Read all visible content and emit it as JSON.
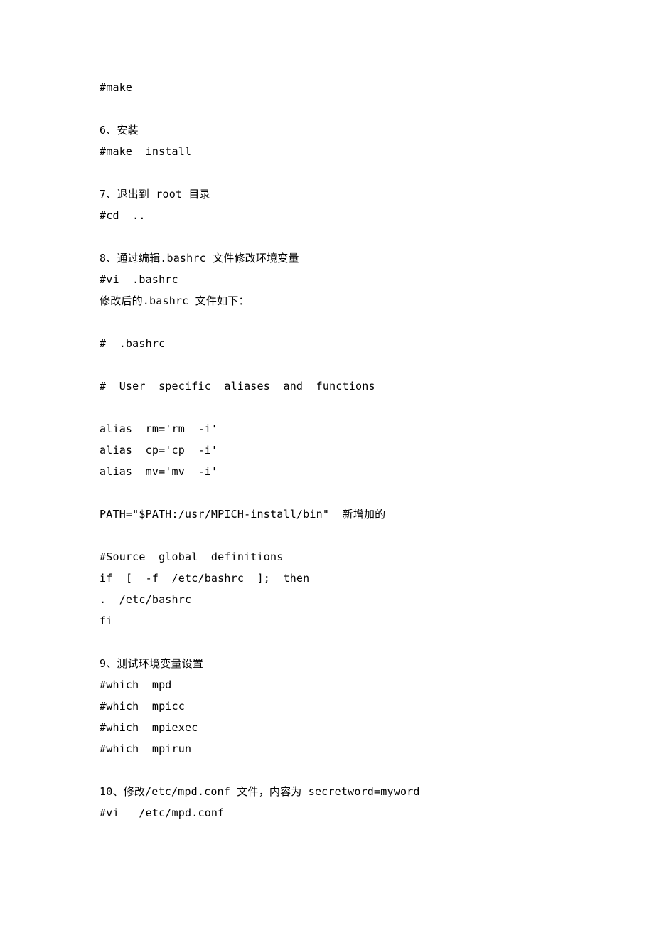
{
  "lines": [
    "#make",
    "",
    "6、安装",
    "#make  install",
    "",
    "7、退出到 root 目录",
    "#cd  ..",
    "",
    "8、通过编辑.bashrc 文件修改环境变量",
    "#vi  .bashrc",
    "修改后的.bashrc 文件如下：",
    "",
    "#  .bashrc",
    "",
    "#  User  specific  aliases  and  functions",
    "",
    "alias  rm='rm  -i'",
    "alias  cp='cp  -i'",
    "alias  mv='mv  -i'",
    "",
    "PATH=\"$PATH:/usr/MPICH-install/bin\"  新增加的",
    "",
    "#Source  global  definitions",
    "if  [  -f  /etc/bashrc  ];  then",
    ".  /etc/bashrc",
    "fi",
    "",
    "9、测试环境变量设置",
    "#which  mpd",
    "#which  mpicc",
    "#which  mpiexec",
    "#which  mpirun",
    "",
    "10、修改/etc/mpd.conf 文件，内容为 secretword=myword",
    "#vi   /etc/mpd.conf"
  ]
}
